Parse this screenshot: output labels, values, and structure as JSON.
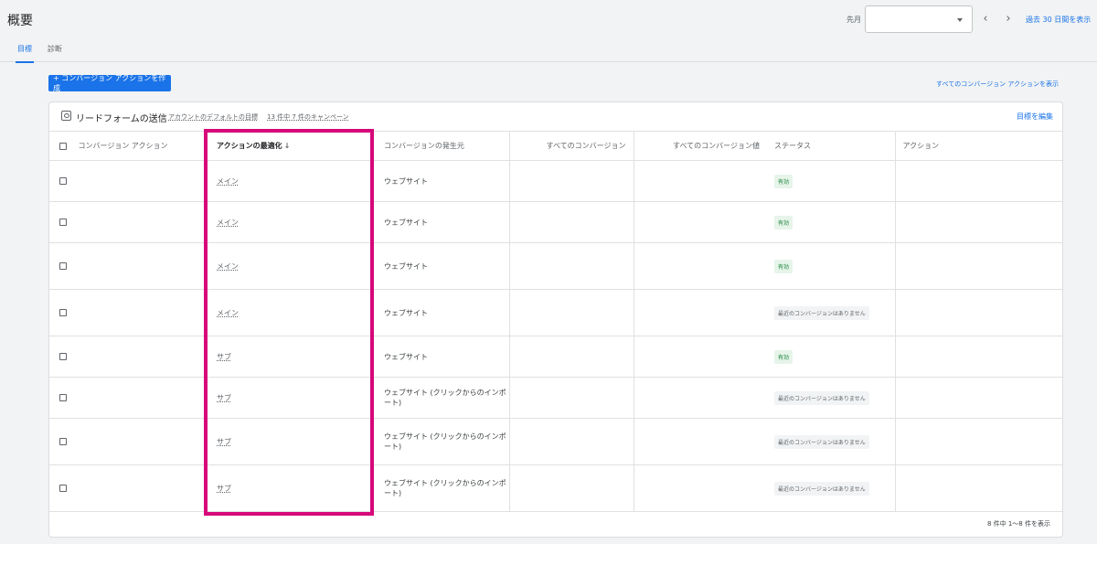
{
  "header": {
    "title": "概要",
    "date_label": "先月",
    "date_value": "",
    "range_link": "過去 30 日間を表示"
  },
  "tabs": [
    {
      "label": "目標",
      "active": true
    },
    {
      "label": "診断",
      "active": false
    }
  ],
  "toolbar": {
    "create_label": "+ コンバージョン アクションを作成",
    "show_all_label": "すべてのコンバージョン アクションを表示"
  },
  "goal": {
    "title": "リードフォームの送信",
    "default_label": "アカウントのデフォルトの目標",
    "campaign_label": "13 件中 7 件のキャンペーン",
    "edit_label": "目標を編集"
  },
  "table": {
    "columns": [
      "コンバージョン アクション",
      "アクションの最適化",
      "コンバージョンの発生元",
      "すべてのコンバージョン",
      "すべてのコンバージョン値",
      "ステータス",
      "アクション"
    ],
    "sort_icon": "arrow-down-icon",
    "rows": [
      {
        "optimization": "メイン",
        "source": "ウェブサイト",
        "status": "有効",
        "status_type": "ok"
      },
      {
        "optimization": "メイン",
        "source": "ウェブサイト",
        "status": "有効",
        "status_type": "ok"
      },
      {
        "optimization": "メイン",
        "source": "ウェブサイト",
        "status": "有効",
        "status_type": "ok"
      },
      {
        "optimization": "メイン",
        "source": "ウェブサイト",
        "status": "最近のコンバージョンはありません",
        "status_type": "none"
      },
      {
        "optimization": "サブ",
        "source": "ウェブサイト",
        "status": "有効",
        "status_type": "ok"
      },
      {
        "optimization": "サブ",
        "source": "ウェブサイト (クリックからのインポート)",
        "status": "最近のコンバージョンはありません",
        "status_type": "none"
      },
      {
        "optimization": "サブ",
        "source": "ウェブサイト (クリックからのインポート)",
        "status": "最近のコンバージョンはありません",
        "status_type": "none"
      },
      {
        "optimization": "サブ",
        "source": "ウェブサイト (クリックからのインポート)",
        "status": "最近のコンバージョンはありません",
        "status_type": "none"
      }
    ],
    "footer": "8 件中 1～8 件を表示"
  },
  "colors": {
    "accent": "#1a73e8",
    "highlight": "#d6087a",
    "status_ok_bg": "#e6f4ea",
    "status_ok_text": "#188038"
  }
}
